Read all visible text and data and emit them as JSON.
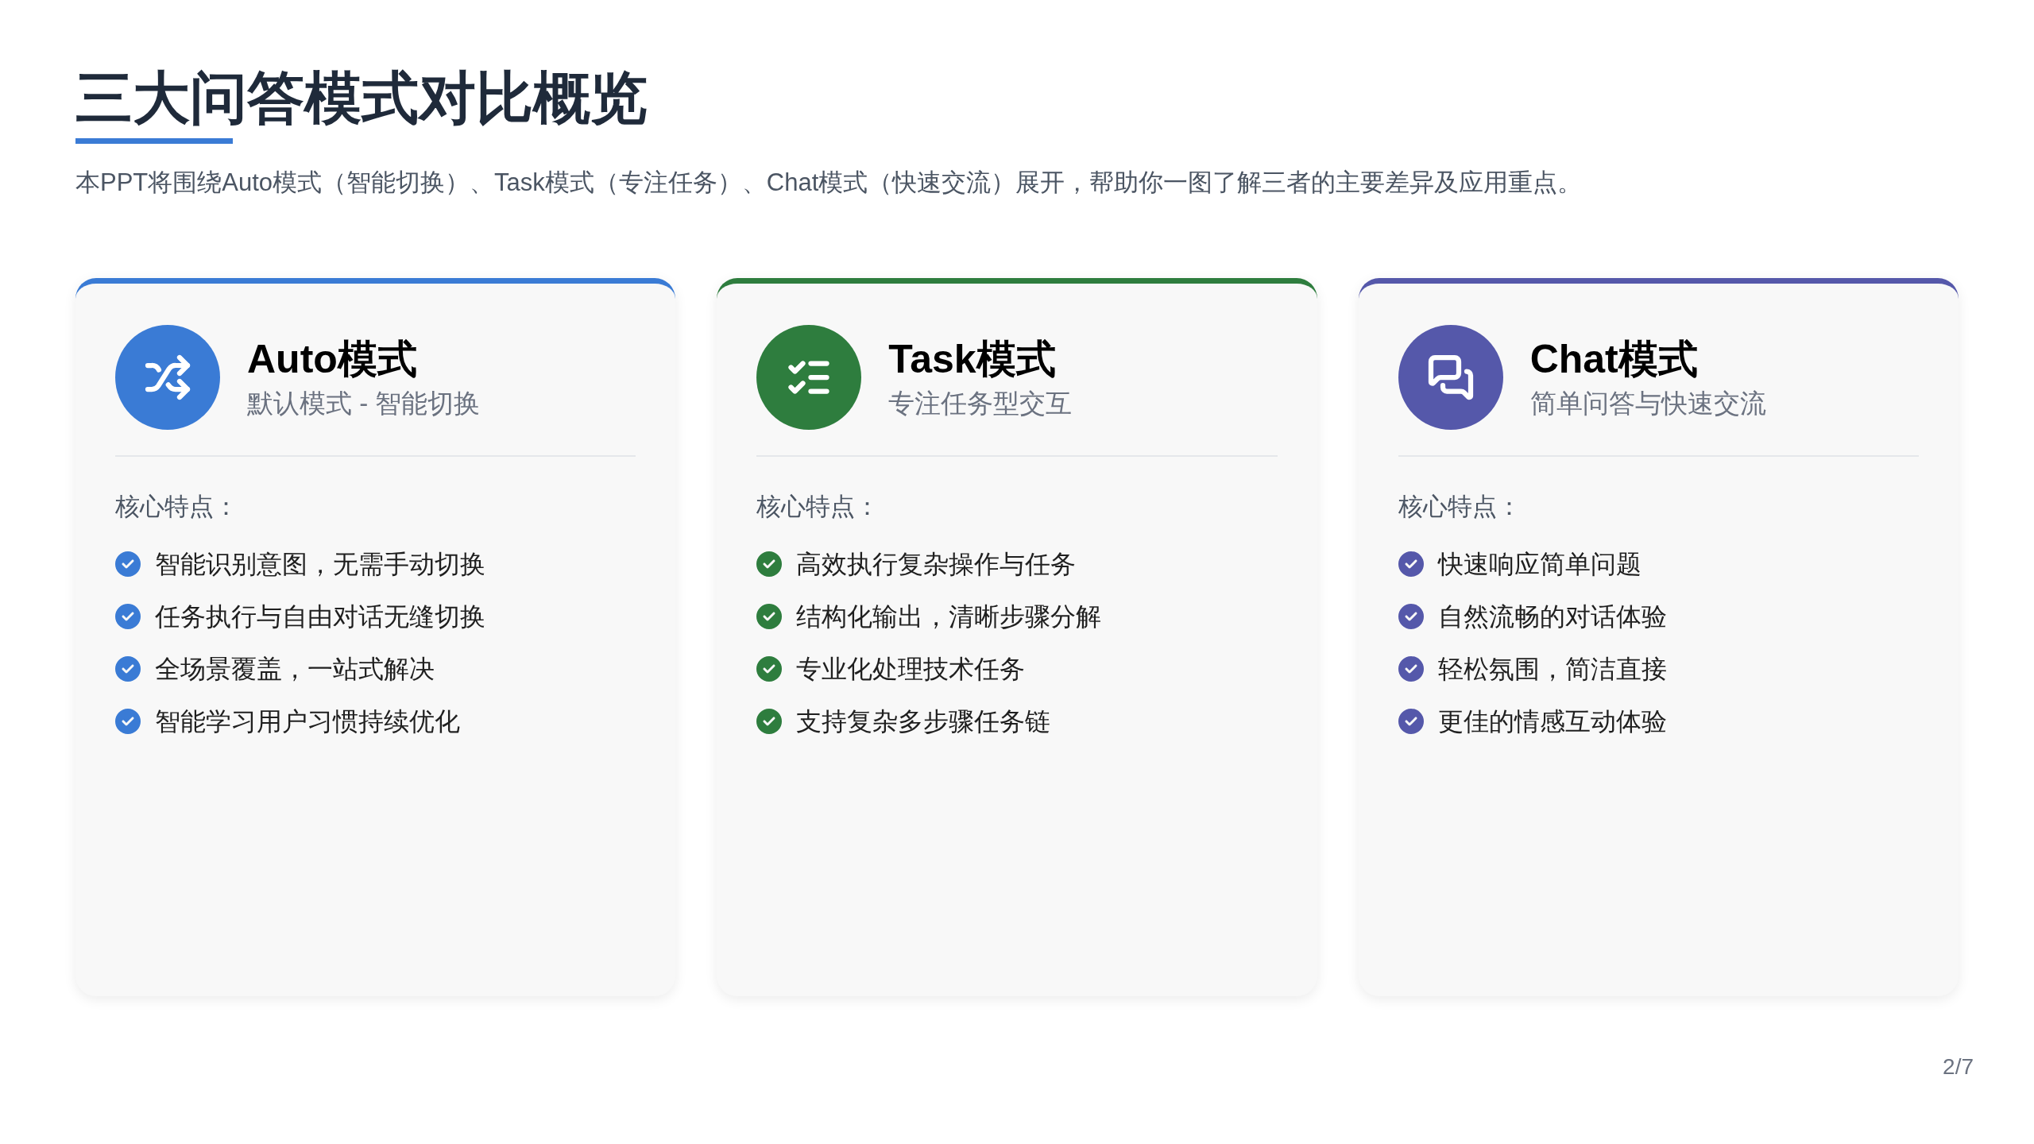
{
  "title": "三大问答模式对比概览",
  "intro": "本PPT将围绕Auto模式（智能切换）、Task模式（专注任务）、Chat模式（快速交流）展开，帮助你一图了解三者的主要差异及应用重点。",
  "cards": [
    {
      "kind": "shuffle",
      "color": "#3a7bd5",
      "name": "Auto模式",
      "tagline": "默认模式 - 智能切换",
      "section_label": "核心特点：",
      "features": [
        "智能识别意图，无需手动切换",
        "任务执行与自由对话无缝切换",
        "全场景覆盖，一站式解决",
        "智能学习用户习惯持续优化"
      ]
    },
    {
      "kind": "tasks",
      "color": "#2e7d3e",
      "name": "Task模式",
      "tagline": "专注任务型交互",
      "section_label": "核心特点：",
      "features": [
        "高效执行复杂操作与任务",
        "结构化输出，清晰步骤分解",
        "专业化处理技术任务",
        "支持复杂多步骤任务链"
      ]
    },
    {
      "kind": "chat",
      "color": "#5558aa",
      "name": "Chat模式",
      "tagline": "简单问答与快速交流",
      "section_label": "核心特点：",
      "features": [
        "快速响应简单问题",
        "自然流畅的对话体验",
        "轻松氛围，简洁直接",
        "更佳的情感互动体验"
      ]
    }
  ],
  "page_number": "2/7"
}
